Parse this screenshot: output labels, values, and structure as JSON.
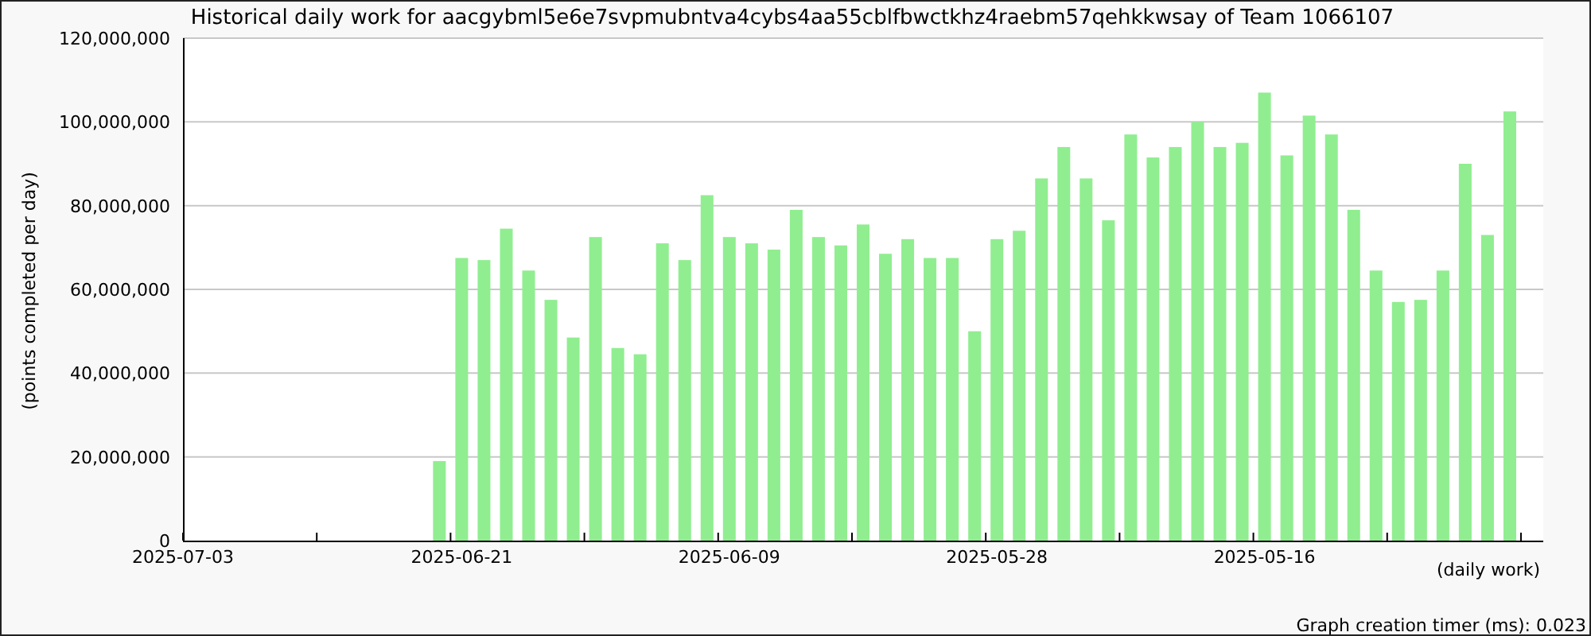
{
  "chart": {
    "chart_data": {
      "type": "bar",
      "title": "Historical daily work for aacgybml5e6e7svpmubntva4cybs4aa55cblfbwctkhz4raebm57qehkkwsay of Team 1066107",
      "xlabel": "(daily work)",
      "ylabel": "(points completed per day)",
      "grid": true,
      "series": [
        {
          "color": "#90ee90",
          "values": [
            null,
            null,
            null,
            null,
            null,
            null,
            null,
            null,
            null,
            null,
            null,
            19000000,
            67500000,
            67000000,
            74500000,
            64500000,
            57500000,
            48500000,
            72500000,
            46000000,
            44500000,
            71000000,
            67000000,
            82500000,
            72500000,
            71000000,
            69500000,
            79000000,
            72500000,
            70500000,
            75500000,
            68500000,
            72000000,
            67500000,
            67500000,
            50000000,
            72000000,
            74000000,
            86500000,
            94000000,
            86500000,
            76500000,
            97000000,
            91500000,
            94000000,
            100000000,
            94000000,
            95000000,
            107000000,
            92000000,
            101500000,
            97000000,
            79000000,
            64500000,
            57000000,
            57500000,
            64500000,
            90000000,
            73000000,
            102500000,
            null
          ]
        }
      ],
      "ylim": [
        0,
        120000000
      ],
      "yticks": [
        {
          "value": 0,
          "label": "0"
        },
        {
          "value": 20000000,
          "label": "20,000,000"
        },
        {
          "value": 40000000,
          "label": "40,000,000"
        },
        {
          "value": 60000000,
          "label": "60,000,000"
        },
        {
          "value": 80000000,
          "label": "80,000,000"
        },
        {
          "value": 100000000,
          "label": "100,000,000"
        },
        {
          "value": 120000000,
          "label": "120,000,000"
        }
      ]
    },
    "date_labels": [
      "2025-07-03",
      "2025-06-21",
      "2025-06-09",
      "2025-05-28",
      "2025-05-16"
    ],
    "footer": "Graph creation timer (ms): 0.023"
  }
}
